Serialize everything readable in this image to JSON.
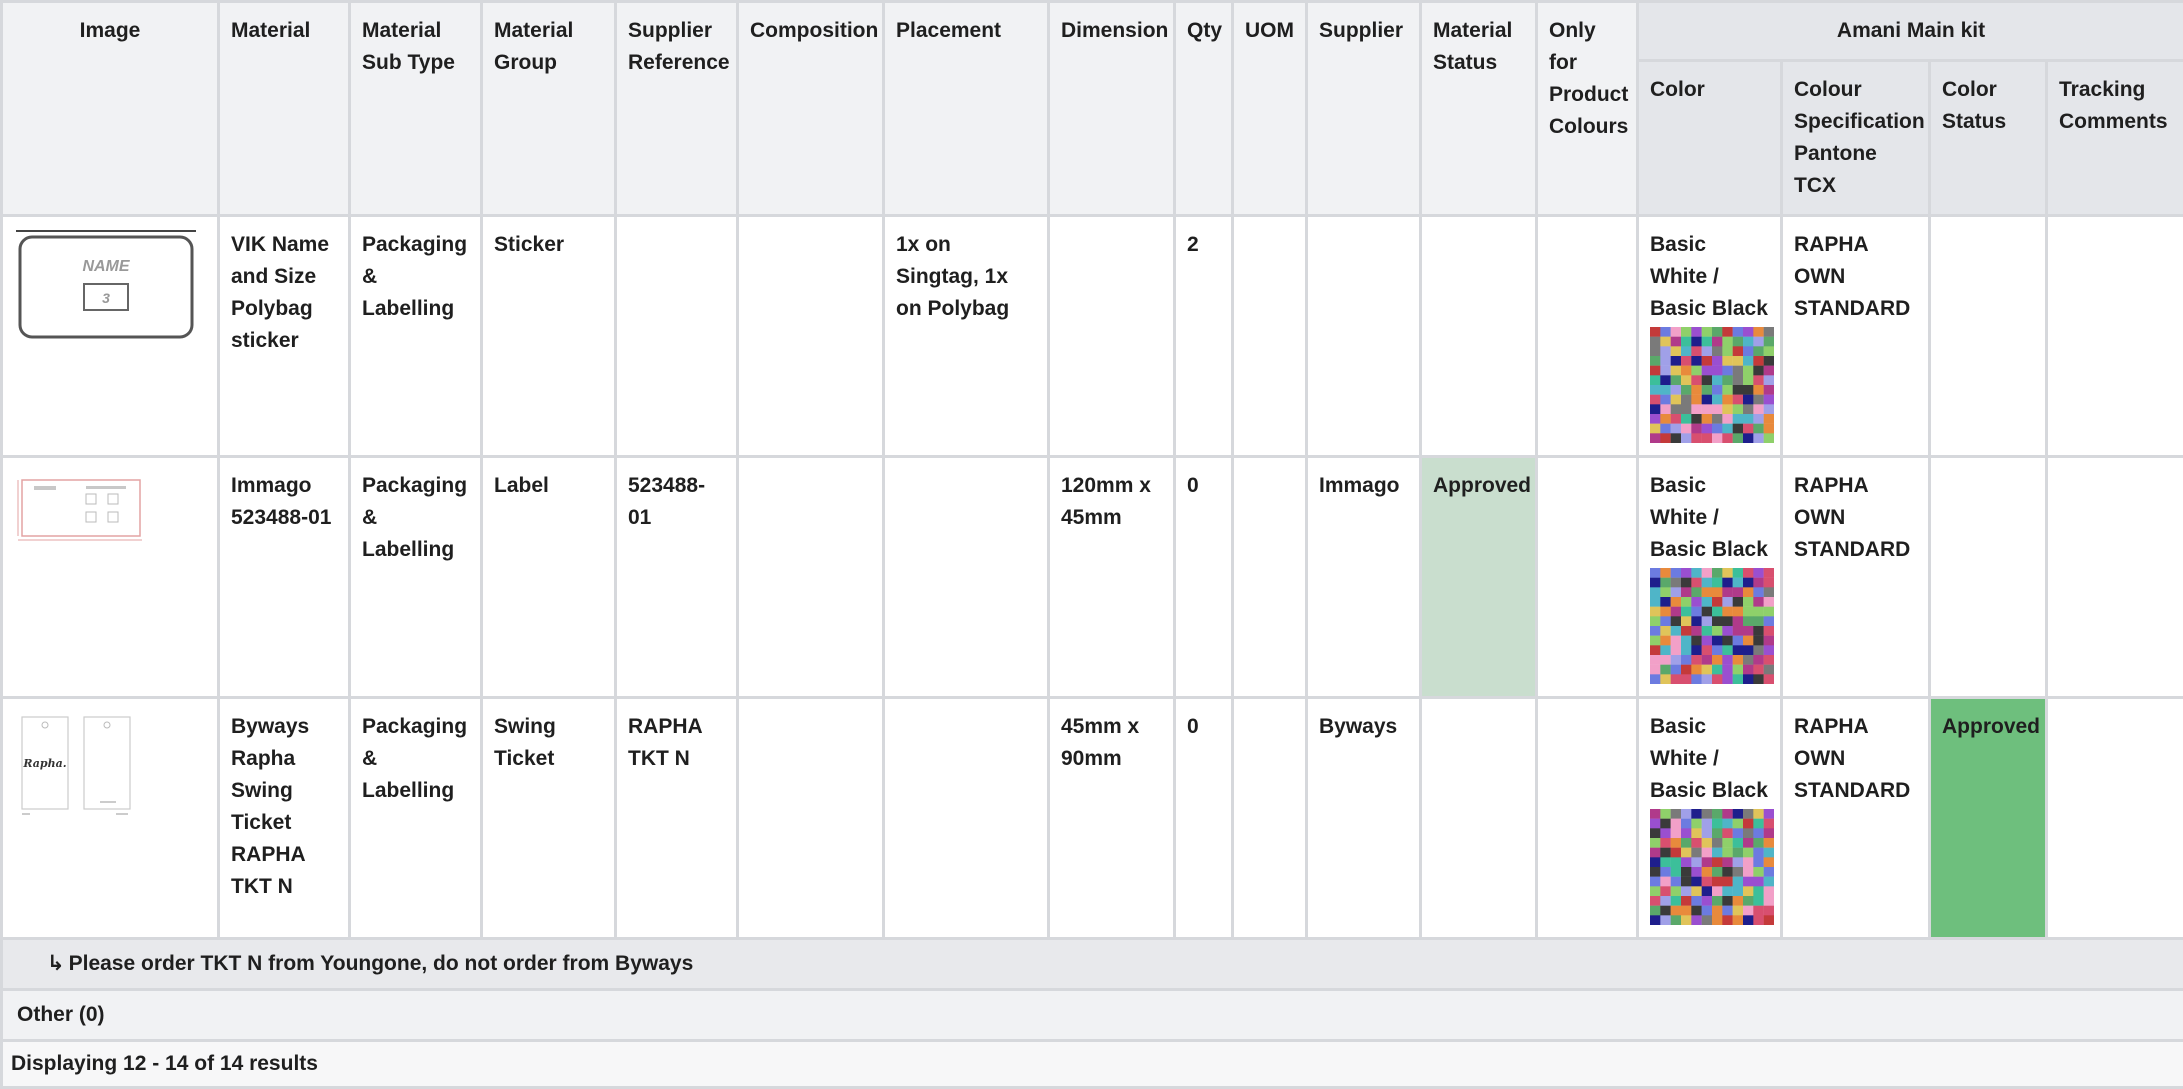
{
  "table": {
    "headers": {
      "image": "Image",
      "material": "Material",
      "material_sub_type": "Material Sub Type",
      "material_group": "Material Group",
      "supplier_reference": "Supplier Reference",
      "composition": "Composition",
      "placement": "Placement",
      "dimension": "Dimension",
      "qty": "Qty",
      "uom": "UOM",
      "supplier": "Supplier",
      "material_status": "Material Status",
      "only_for_product_colours": "Only for Product Colours",
      "kit_group": "Amani Main kit",
      "color": "Color",
      "colour_spec": "Colour Specification Pantone TCX",
      "color_status": "Color Status",
      "tracking_comments": "Tracking Comments"
    },
    "rows": [
      {
        "thumb_name": "NAME",
        "thumb_size": "3",
        "material": "VIK Name and Size Polybag sticker",
        "sub_type": "Packaging & Labelling",
        "group": "Sticker",
        "supplier_ref": "",
        "composition": "",
        "placement": "1x on Singtag, 1x on Polybag",
        "dimension": "",
        "qty": "2",
        "uom": "",
        "supplier": "",
        "material_status": "",
        "only_for": "",
        "color": "Basic White / Basic Black",
        "colour_spec": "RAPHA OWN STANDARD",
        "color_status": "",
        "tracking": ""
      },
      {
        "material": "Immago 523488-01",
        "sub_type": "Packaging & Labelling",
        "group": "Label",
        "supplier_ref": "523488-01",
        "composition": "",
        "placement": "",
        "dimension": "120mm x 45mm",
        "qty": "0",
        "uom": "",
        "supplier": "Immago",
        "material_status": "Approved",
        "only_for": "",
        "color": "Basic White / Basic Black",
        "colour_spec": "RAPHA OWN STANDARD",
        "color_status": "",
        "tracking": ""
      },
      {
        "thumb_brand": "Rapha.",
        "material": "Byways Rapha Swing Ticket RAPHA TKT N",
        "sub_type": "Packaging & Labelling",
        "group": "Swing Ticket",
        "supplier_ref": "RAPHA TKT N",
        "composition": "",
        "placement": "",
        "dimension": "45mm x 90mm",
        "qty": "0",
        "uom": "",
        "supplier": "Byways",
        "material_status": "",
        "only_for": "",
        "color": "Basic White / Basic Black",
        "colour_spec": "RAPHA OWN STANDARD",
        "color_status": "Approved",
        "tracking": ""
      }
    ],
    "note_arrow": "↳",
    "note": "Please order TKT N from Youngone, do not order from Byways",
    "other_label": "Other (0)",
    "footer": "Displaying 12 - 14 of 14 results"
  },
  "colors": {
    "approved_light": "#c9dece",
    "approved_dark": "#6ebf7d",
    "header_bg": "#f1f2f4",
    "border": "#d6d8dc"
  }
}
